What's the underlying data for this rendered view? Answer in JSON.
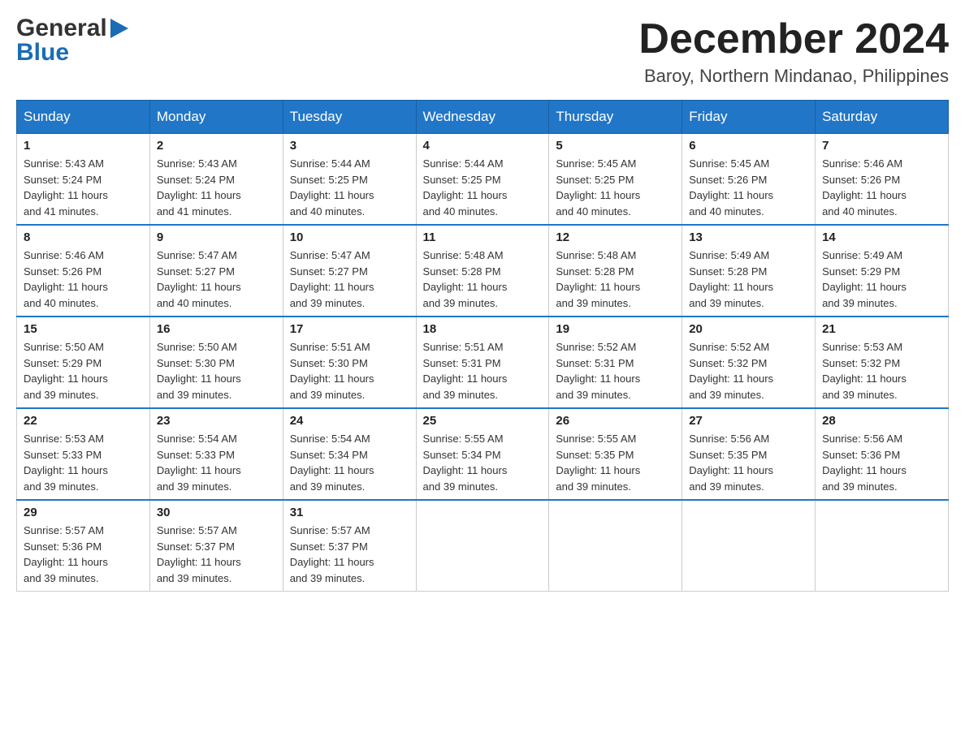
{
  "header": {
    "logo_general": "General",
    "logo_blue": "Blue",
    "month_title": "December 2024",
    "location": "Baroy, Northern Mindanao, Philippines"
  },
  "weekdays": [
    "Sunday",
    "Monday",
    "Tuesday",
    "Wednesday",
    "Thursday",
    "Friday",
    "Saturday"
  ],
  "weeks": [
    [
      {
        "day": "1",
        "sunrise": "5:43 AM",
        "sunset": "5:24 PM",
        "daylight": "11 hours and 41 minutes."
      },
      {
        "day": "2",
        "sunrise": "5:43 AM",
        "sunset": "5:24 PM",
        "daylight": "11 hours and 41 minutes."
      },
      {
        "day": "3",
        "sunrise": "5:44 AM",
        "sunset": "5:25 PM",
        "daylight": "11 hours and 40 minutes."
      },
      {
        "day": "4",
        "sunrise": "5:44 AM",
        "sunset": "5:25 PM",
        "daylight": "11 hours and 40 minutes."
      },
      {
        "day": "5",
        "sunrise": "5:45 AM",
        "sunset": "5:25 PM",
        "daylight": "11 hours and 40 minutes."
      },
      {
        "day": "6",
        "sunrise": "5:45 AM",
        "sunset": "5:26 PM",
        "daylight": "11 hours and 40 minutes."
      },
      {
        "day": "7",
        "sunrise": "5:46 AM",
        "sunset": "5:26 PM",
        "daylight": "11 hours and 40 minutes."
      }
    ],
    [
      {
        "day": "8",
        "sunrise": "5:46 AM",
        "sunset": "5:26 PM",
        "daylight": "11 hours and 40 minutes."
      },
      {
        "day": "9",
        "sunrise": "5:47 AM",
        "sunset": "5:27 PM",
        "daylight": "11 hours and 40 minutes."
      },
      {
        "day": "10",
        "sunrise": "5:47 AM",
        "sunset": "5:27 PM",
        "daylight": "11 hours and 39 minutes."
      },
      {
        "day": "11",
        "sunrise": "5:48 AM",
        "sunset": "5:28 PM",
        "daylight": "11 hours and 39 minutes."
      },
      {
        "day": "12",
        "sunrise": "5:48 AM",
        "sunset": "5:28 PM",
        "daylight": "11 hours and 39 minutes."
      },
      {
        "day": "13",
        "sunrise": "5:49 AM",
        "sunset": "5:28 PM",
        "daylight": "11 hours and 39 minutes."
      },
      {
        "day": "14",
        "sunrise": "5:49 AM",
        "sunset": "5:29 PM",
        "daylight": "11 hours and 39 minutes."
      }
    ],
    [
      {
        "day": "15",
        "sunrise": "5:50 AM",
        "sunset": "5:29 PM",
        "daylight": "11 hours and 39 minutes."
      },
      {
        "day": "16",
        "sunrise": "5:50 AM",
        "sunset": "5:30 PM",
        "daylight": "11 hours and 39 minutes."
      },
      {
        "day": "17",
        "sunrise": "5:51 AM",
        "sunset": "5:30 PM",
        "daylight": "11 hours and 39 minutes."
      },
      {
        "day": "18",
        "sunrise": "5:51 AM",
        "sunset": "5:31 PM",
        "daylight": "11 hours and 39 minutes."
      },
      {
        "day": "19",
        "sunrise": "5:52 AM",
        "sunset": "5:31 PM",
        "daylight": "11 hours and 39 minutes."
      },
      {
        "day": "20",
        "sunrise": "5:52 AM",
        "sunset": "5:32 PM",
        "daylight": "11 hours and 39 minutes."
      },
      {
        "day": "21",
        "sunrise": "5:53 AM",
        "sunset": "5:32 PM",
        "daylight": "11 hours and 39 minutes."
      }
    ],
    [
      {
        "day": "22",
        "sunrise": "5:53 AM",
        "sunset": "5:33 PM",
        "daylight": "11 hours and 39 minutes."
      },
      {
        "day": "23",
        "sunrise": "5:54 AM",
        "sunset": "5:33 PM",
        "daylight": "11 hours and 39 minutes."
      },
      {
        "day": "24",
        "sunrise": "5:54 AM",
        "sunset": "5:34 PM",
        "daylight": "11 hours and 39 minutes."
      },
      {
        "day": "25",
        "sunrise": "5:55 AM",
        "sunset": "5:34 PM",
        "daylight": "11 hours and 39 minutes."
      },
      {
        "day": "26",
        "sunrise": "5:55 AM",
        "sunset": "5:35 PM",
        "daylight": "11 hours and 39 minutes."
      },
      {
        "day": "27",
        "sunrise": "5:56 AM",
        "sunset": "5:35 PM",
        "daylight": "11 hours and 39 minutes."
      },
      {
        "day": "28",
        "sunrise": "5:56 AM",
        "sunset": "5:36 PM",
        "daylight": "11 hours and 39 minutes."
      }
    ],
    [
      {
        "day": "29",
        "sunrise": "5:57 AM",
        "sunset": "5:36 PM",
        "daylight": "11 hours and 39 minutes."
      },
      {
        "day": "30",
        "sunrise": "5:57 AM",
        "sunset": "5:37 PM",
        "daylight": "11 hours and 39 minutes."
      },
      {
        "day": "31",
        "sunrise": "5:57 AM",
        "sunset": "5:37 PM",
        "daylight": "11 hours and 39 minutes."
      },
      null,
      null,
      null,
      null
    ]
  ],
  "labels": {
    "sunrise": "Sunrise: ",
    "sunset": "Sunset: ",
    "daylight": "Daylight: "
  }
}
